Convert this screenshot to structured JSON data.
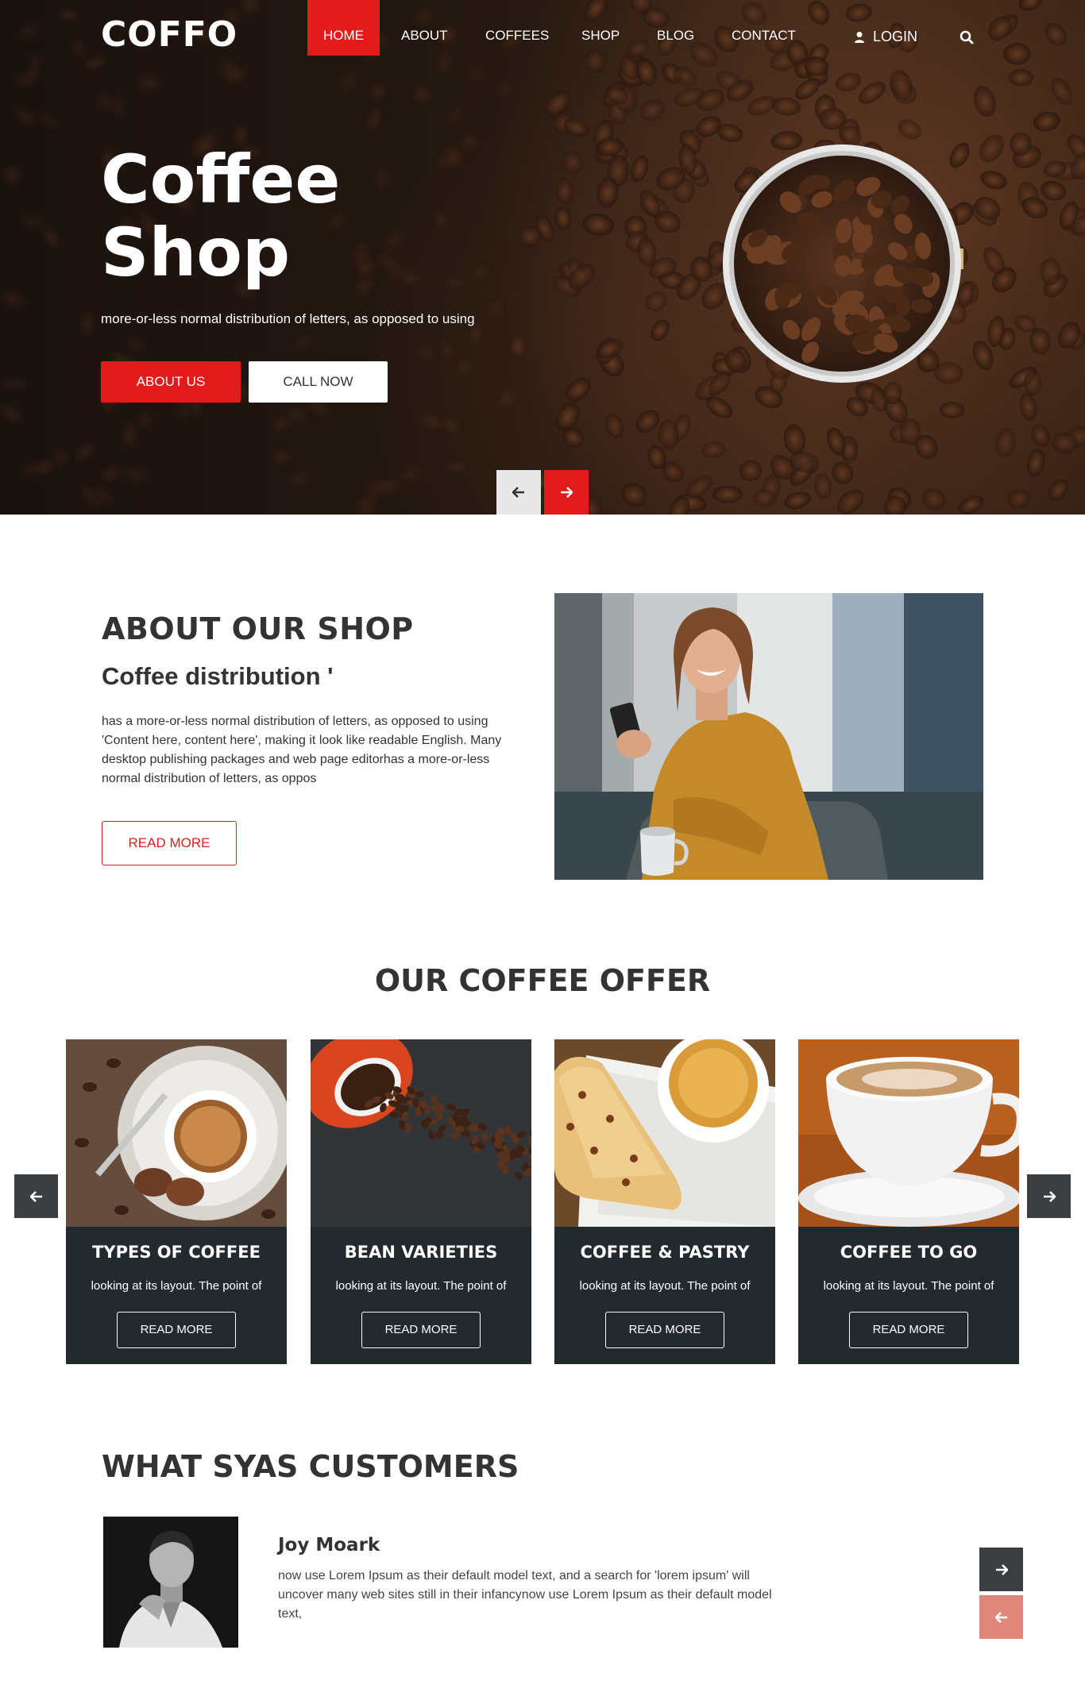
{
  "colors": {
    "accent": "#e31b1b",
    "dark_card": "#232a2d",
    "arrow_dark": "#3b3f41",
    "arrow_light_red": "#e0877c"
  },
  "nav": {
    "logo": "COFFO",
    "items": [
      {
        "label": "HOME",
        "active": true
      },
      {
        "label": "ABOUT",
        "active": false
      },
      {
        "label": "COFFEES",
        "active": false
      },
      {
        "label": "SHOP",
        "active": false
      },
      {
        "label": "BLOG",
        "active": false
      },
      {
        "label": "CONTACT",
        "active": false
      }
    ],
    "login_label": "LOGIN",
    "login_icon": "user-icon",
    "search_icon": "search-icon"
  },
  "hero": {
    "title_line1": "Coffee",
    "title_line2": "Shop",
    "subtitle": "more-or-less normal distribution of letters, as opposed to using",
    "primary_button": "ABOUT US",
    "secondary_button": "CALL NOW",
    "prev_icon": "arrow-left-icon",
    "next_icon": "arrow-right-icon"
  },
  "about": {
    "title": "ABOUT OUR SHOP",
    "subtitle": "Coffee distribution '",
    "text": "has a more-or-less normal distribution of letters, as opposed to using 'Content here, content here', making it look like readable English. Many desktop publishing packages and web page editorhas a more-or-less normal distribution of letters, as oppos",
    "button": "READ MORE"
  },
  "offer": {
    "title": "OUR COFFEE OFFER",
    "cards": [
      {
        "title": "TYPES OF COFFEE",
        "text": "looking at its layout. The point of",
        "button": "READ MORE"
      },
      {
        "title": "BEAN VARIETIES",
        "text": "looking at its layout. The point of",
        "button": "READ MORE"
      },
      {
        "title": "COFFEE & PASTRY",
        "text": "looking at its layout. The point of",
        "button": "READ MORE"
      },
      {
        "title": "COFFEE TO GO",
        "text": "looking at its layout. The point of",
        "button": "READ MORE"
      }
    ]
  },
  "customers": {
    "title": "WHAT SYAS CUSTOMERS",
    "name": "Joy Moark",
    "text": "now use Lorem Ipsum as their default model text, and a search for 'lorem ipsum' will uncover many web sites still in their infancynow use Lorem Ipsum as their default model text,"
  }
}
